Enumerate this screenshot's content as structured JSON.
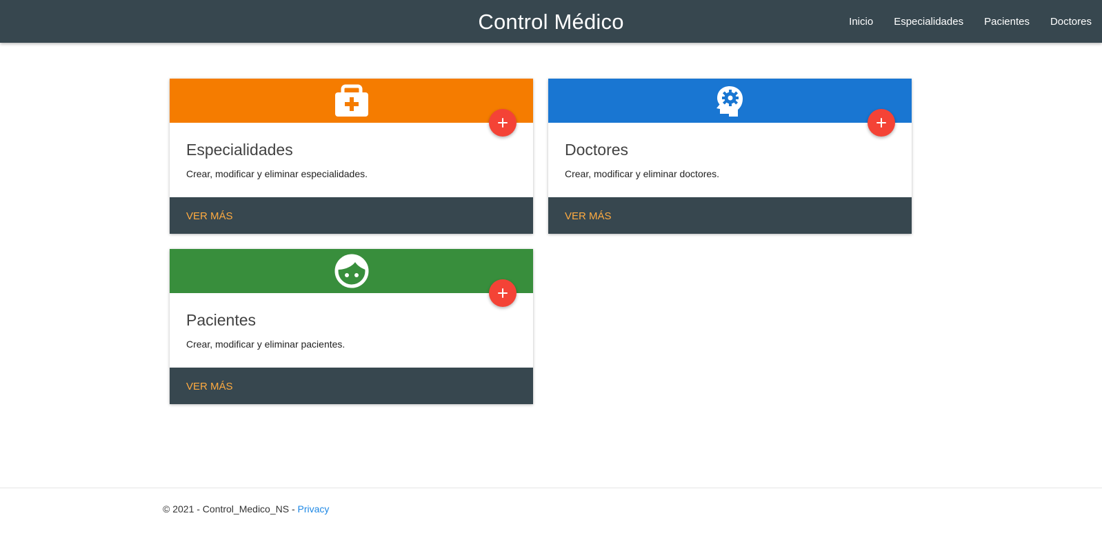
{
  "colors": {
    "navbar": "#37474f",
    "especialidades": "#f57c00",
    "doctores": "#1976d2",
    "pacientes": "#388e3c",
    "fab": "#f44336",
    "action_link": "#ffab40",
    "footer_link": "#1e88e5"
  },
  "navbar": {
    "brand": "Control Médico",
    "links": [
      "Inicio",
      "Especialidades",
      "Pacientes",
      "Doctores"
    ]
  },
  "cards": [
    {
      "icon": "medical-bag-icon",
      "title": "Especialidades",
      "text": "Crear, modificar y eliminar especialidades.",
      "action": "Ver más"
    },
    {
      "icon": "head-cog-icon",
      "title": "Doctores",
      "text": "Crear, modificar y eliminar doctores.",
      "action": "Ver más"
    },
    {
      "icon": "face-icon",
      "title": "Pacientes",
      "text": "Crear, modificar y eliminar pacientes.",
      "action": "Ver más"
    }
  ],
  "footer": {
    "copyright": "© 2021 - Control_Medico_NS - ",
    "privacy_link": "Privacy"
  }
}
